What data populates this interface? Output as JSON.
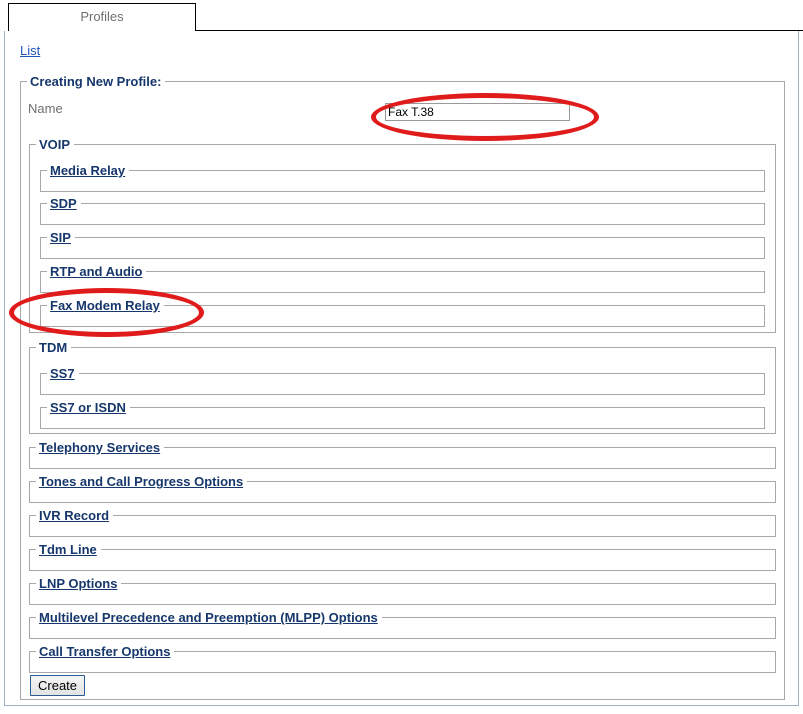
{
  "tab": {
    "label": "Profiles"
  },
  "nav": {
    "list_link": "List"
  },
  "form": {
    "legend": "Creating New Profile:",
    "name_label": "Name",
    "name_value": "Fax T.38",
    "name_placeholder": "",
    "create_label": "Create"
  },
  "groups": [
    {
      "legend": "VOIP",
      "sections": [
        {
          "label": "Media Relay"
        },
        {
          "label": "SDP"
        },
        {
          "label": "SIP"
        },
        {
          "label": "RTP and Audio"
        },
        {
          "label": "Fax Modem Relay"
        }
      ]
    },
    {
      "legend": "TDM",
      "sections": [
        {
          "label": "SS7"
        },
        {
          "label": "SS7 or ISDN"
        }
      ]
    }
  ],
  "sections": [
    {
      "label": "Telephony Services"
    },
    {
      "label": "Tones and Call Progress Options"
    },
    {
      "label": "IVR Record"
    },
    {
      "label": "Tdm Line"
    },
    {
      "label": "LNP Options"
    },
    {
      "label": "Multilevel Precedence and Preemption (MLPP) Options"
    },
    {
      "label": "Call Transfer Options"
    }
  ],
  "annotations": {
    "color": "#e01b1b",
    "highlighted_name_field": "Fax T.38",
    "highlighted_section": "Fax Modem Relay"
  },
  "colors": {
    "link": "#16376b",
    "nav_link": "#2255bb",
    "label": "#6f6f6f",
    "border": "#a8a8a8",
    "annotation": "#e01b1b"
  }
}
